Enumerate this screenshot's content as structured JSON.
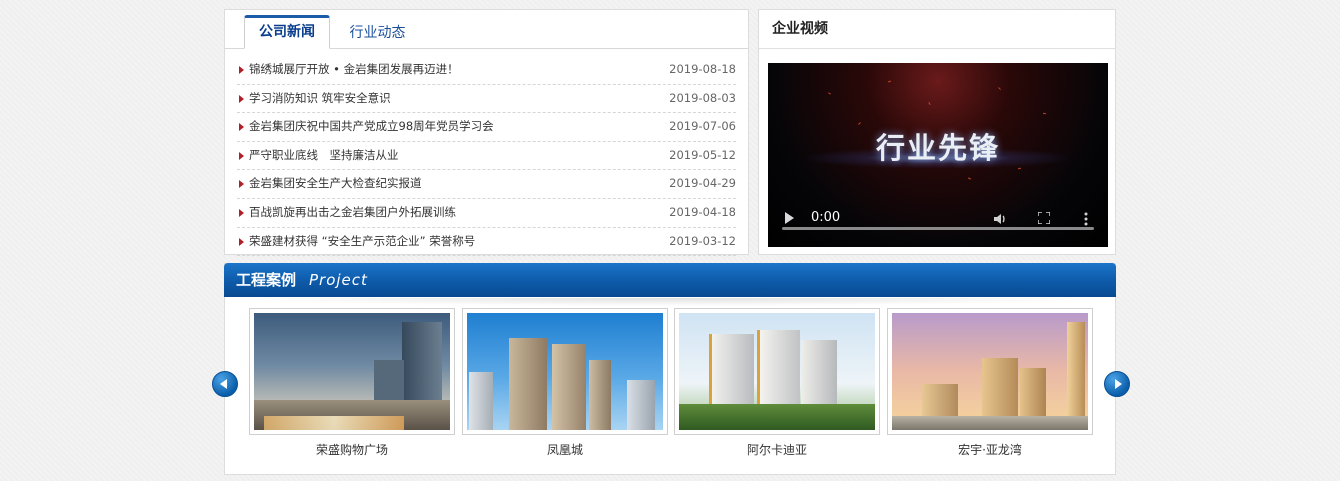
{
  "news": {
    "tabs": [
      {
        "label": "公司新闻",
        "active": true
      },
      {
        "label": "行业动态",
        "active": false
      }
    ],
    "items": [
      {
        "title": "锦绣城展厅开放 • 金岩集团发展再迈进！",
        "date": "2019-08-18"
      },
      {
        "title": "学习消防知识 筑牢安全意识",
        "date": "2019-08-03"
      },
      {
        "title": "金岩集团庆祝中国共产党成立98周年党员学习会",
        "date": "2019-07-06"
      },
      {
        "title": "严守职业底线　坚持廉洁从业",
        "date": "2019-05-12"
      },
      {
        "title": "金岩集团安全生产大检查纪实报道",
        "date": "2019-04-29"
      },
      {
        "title": "百战凯旋再出击之金岩集团户外拓展训练",
        "date": "2019-04-18"
      },
      {
        "title": "荣盛建材获得 “安全生产示范企业” 荣誉称号",
        "date": "2019-03-12"
      }
    ]
  },
  "video": {
    "header": "企业视频",
    "poster_text": "行业先锋",
    "time": "0:00",
    "progress": 0,
    "icons": [
      "play-icon",
      "volume-icon",
      "fullscreen-icon",
      "more-icon"
    ]
  },
  "projects": {
    "title_cn": "工程案例",
    "title_en": "Project",
    "cases": [
      {
        "label": "荣盛购物广场"
      },
      {
        "label": "凤凰城"
      },
      {
        "label": "阿尔卡迪亚"
      },
      {
        "label": "宏宇·亚龙湾"
      }
    ],
    "icons": [
      "arrow-left-icon",
      "arrow-right-icon"
    ]
  },
  "colors": {
    "accent": "#0e5aa9",
    "tab_active_text": "#0a3e8c",
    "bullet": "#b0202a"
  }
}
